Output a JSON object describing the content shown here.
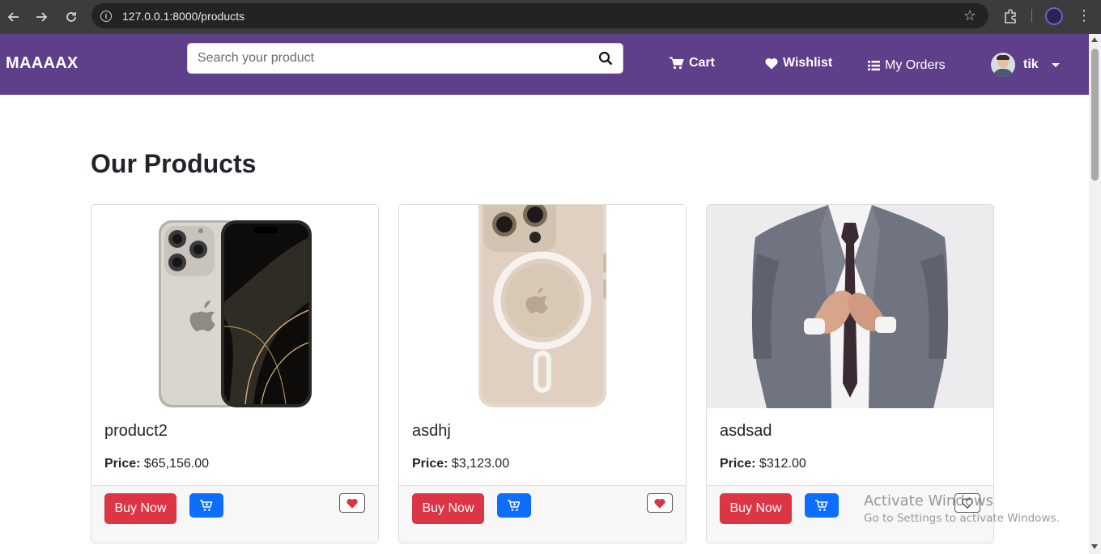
{
  "browser": {
    "url": "127.0.0.1:8000/products"
  },
  "navbar": {
    "brand": "MAAAAX",
    "search_placeholder": "Search your product",
    "cart_label": "Cart",
    "wishlist_label": "Wishlist",
    "orders_label": "My Orders",
    "user_name": "tik"
  },
  "page": {
    "heading": "Our Products"
  },
  "products": [
    {
      "name": "product2",
      "price_label": "Price:",
      "price": "$65,156.00",
      "buy_label": "Buy Now"
    },
    {
      "name": "asdhj",
      "price_label": "Price:",
      "price": "$3,123.00",
      "buy_label": "Buy Now"
    },
    {
      "name": "asdsad",
      "price_label": "Price:",
      "price": "$312.00",
      "buy_label": "Buy Now"
    }
  ],
  "watermark": {
    "line1": "Activate Windows",
    "line2": "Go to Settings to activate Windows."
  },
  "colors": {
    "navbar": "#5e3f8a",
    "buy": "#dc3545",
    "cart": "#0d6efd",
    "heart": "#dc3545"
  }
}
